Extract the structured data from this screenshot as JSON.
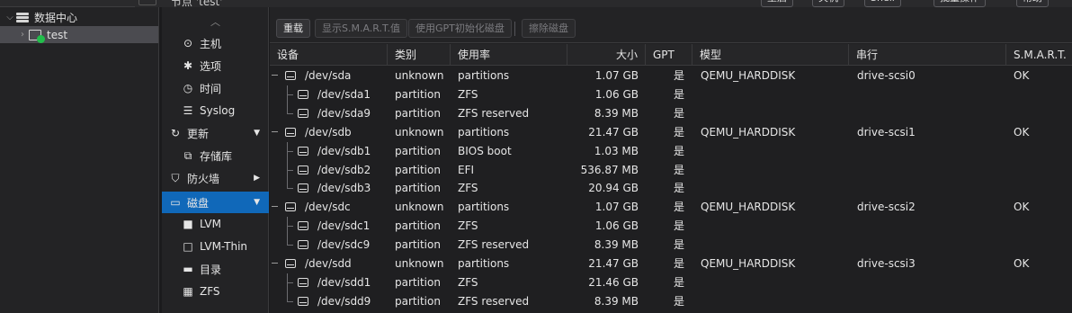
{
  "header": {
    "node_title": "节点 'test'",
    "buttons": [
      "重启",
      "关机",
      "Shell",
      "批量操作",
      "帮助"
    ]
  },
  "tree": {
    "datacenter_label": "数据中心",
    "node_label": "test"
  },
  "menu": {
    "items": [
      {
        "label": "主机",
        "icon": "search-icon"
      },
      {
        "label": "选项",
        "icon": "gear-icon"
      },
      {
        "label": "时间",
        "icon": "clock-icon"
      },
      {
        "label": "Syslog",
        "icon": "list-icon"
      },
      {
        "label": "更新",
        "icon": "refresh-icon"
      },
      {
        "label": "存储库",
        "icon": "repository-icon"
      },
      {
        "label": "防火墙",
        "icon": "shield-icon"
      },
      {
        "label": "磁盘",
        "icon": "disk-icon"
      },
      {
        "label": "LVM",
        "icon": "square-icon"
      },
      {
        "label": "LVM-Thin",
        "icon": "square-outline-icon"
      },
      {
        "label": "目录",
        "icon": "folder-icon"
      },
      {
        "label": "ZFS",
        "icon": "grid-icon"
      }
    ]
  },
  "toolbar": {
    "reload": "重载",
    "show_smart": "显示S.M.A.R.T.值",
    "init_gpt": "使用GPT初始化磁盘",
    "wipe": "擦除磁盘"
  },
  "columns": {
    "device": "设备",
    "type": "类别",
    "usage": "使用率",
    "size": "大小",
    "gpt": "GPT",
    "model": "模型",
    "serial": "串行",
    "smart": "S.M.A.R.T."
  },
  "rows": [
    {
      "device": "/dev/sda",
      "type": "unknown",
      "usage": "partitions",
      "size": "1.07 GB",
      "gpt": "是",
      "model": "QEMU_HARDDISK",
      "serial": "drive-scsi0",
      "smart": "OK",
      "child": false
    },
    {
      "device": "/dev/sda1",
      "type": "partition",
      "usage": "ZFS",
      "size": "1.06 GB",
      "gpt": "是",
      "model": "",
      "serial": "",
      "smart": "",
      "child": true
    },
    {
      "device": "/dev/sda9",
      "type": "partition",
      "usage": "ZFS reserved",
      "size": "8.39 MB",
      "gpt": "是",
      "model": "",
      "serial": "",
      "smart": "",
      "child": true
    },
    {
      "device": "/dev/sdb",
      "type": "unknown",
      "usage": "partitions",
      "size": "21.47 GB",
      "gpt": "是",
      "model": "QEMU_HARDDISK",
      "serial": "drive-scsi1",
      "smart": "OK",
      "child": false
    },
    {
      "device": "/dev/sdb1",
      "type": "partition",
      "usage": "BIOS boot",
      "size": "1.03 MB",
      "gpt": "是",
      "model": "",
      "serial": "",
      "smart": "",
      "child": true
    },
    {
      "device": "/dev/sdb2",
      "type": "partition",
      "usage": "EFI",
      "size": "536.87 MB",
      "gpt": "是",
      "model": "",
      "serial": "",
      "smart": "",
      "child": true
    },
    {
      "device": "/dev/sdb3",
      "type": "partition",
      "usage": "ZFS",
      "size": "20.94 GB",
      "gpt": "是",
      "model": "",
      "serial": "",
      "smart": "",
      "child": true
    },
    {
      "device": "/dev/sdc",
      "type": "unknown",
      "usage": "partitions",
      "size": "1.07 GB",
      "gpt": "是",
      "model": "QEMU_HARDDISK",
      "serial": "drive-scsi2",
      "smart": "OK",
      "child": false
    },
    {
      "device": "/dev/sdc1",
      "type": "partition",
      "usage": "ZFS",
      "size": "1.06 GB",
      "gpt": "是",
      "model": "",
      "serial": "",
      "smart": "",
      "child": true
    },
    {
      "device": "/dev/sdc9",
      "type": "partition",
      "usage": "ZFS reserved",
      "size": "8.39 MB",
      "gpt": "是",
      "model": "",
      "serial": "",
      "smart": "",
      "child": true
    },
    {
      "device": "/dev/sdd",
      "type": "unknown",
      "usage": "partitions",
      "size": "21.47 GB",
      "gpt": "是",
      "model": "QEMU_HARDDISK",
      "serial": "drive-scsi3",
      "smart": "OK",
      "child": false
    },
    {
      "device": "/dev/sdd1",
      "type": "partition",
      "usage": "ZFS",
      "size": "21.46 GB",
      "gpt": "是",
      "model": "",
      "serial": "",
      "smart": "",
      "child": true
    },
    {
      "device": "/dev/sdd9",
      "type": "partition",
      "usage": "ZFS reserved",
      "size": "8.39 MB",
      "gpt": "是",
      "model": "",
      "serial": "",
      "smart": "",
      "child": true
    }
  ]
}
